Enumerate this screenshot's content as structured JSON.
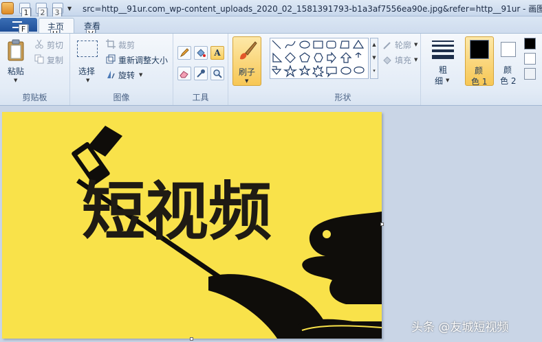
{
  "window": {
    "title": "src=http__91ur.com_wp-content_uploads_2020_02_1581391793-b1a3af7556ea90e.jpg&refer=http__91ur - 画图"
  },
  "keytips": {
    "qat1": "1",
    "qat2": "2",
    "qat3": "3",
    "file": "F",
    "home": "H",
    "view": "V"
  },
  "tabs": {
    "home": "主页",
    "view": "查看"
  },
  "ribbon": {
    "clipboard": {
      "paste": "粘贴",
      "cut": "剪切",
      "copy": "复制",
      "label": "剪贴板"
    },
    "image": {
      "select": "选择",
      "crop": "裁剪",
      "resize": "重新调整大小",
      "rotate": "旋转",
      "label": "图像"
    },
    "tools": {
      "label": "工具"
    },
    "brushes": {
      "label": "刷子"
    },
    "shapes": {
      "outline": "轮廓",
      "fill": "填充",
      "label": "形状"
    },
    "size": {
      "label_line1": "粗",
      "label_line2": "细"
    },
    "colors": {
      "color1_line1": "颜",
      "color1_line2": "色 1",
      "color2_line1": "颜",
      "color2_line2": "色 2",
      "color1_value": "#000000",
      "color2_value": "#ffffff"
    }
  },
  "canvas": {
    "headline": "短视频",
    "background": "#f9e24a"
  },
  "watermark": "头条 @友城短视频"
}
